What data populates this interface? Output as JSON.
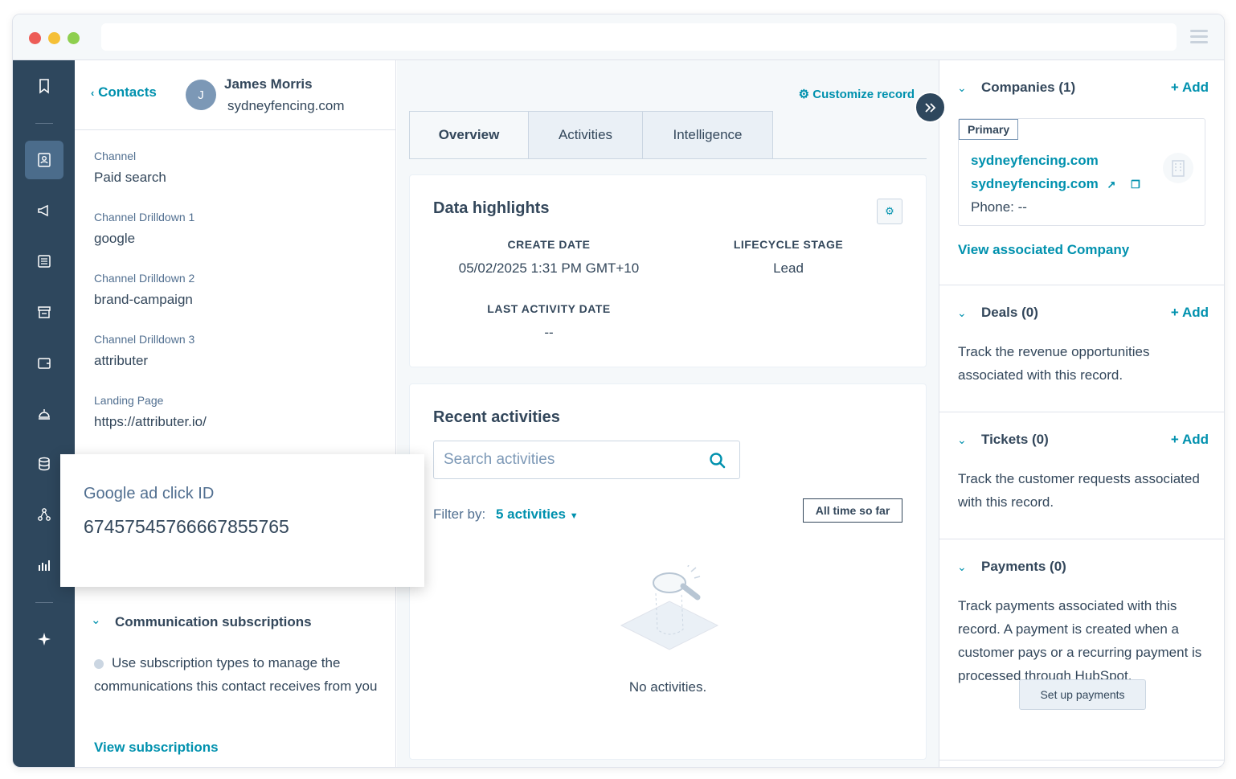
{
  "contact": {
    "back_label": "Contacts",
    "avatar_initial": "J",
    "name": "James Morris",
    "domain": "sydneyfencing.com"
  },
  "properties": [
    {
      "label": "Channel",
      "value": "Paid search"
    },
    {
      "label": "Channel Drilldown 1",
      "value": "google"
    },
    {
      "label": "Channel Drilldown 2",
      "value": "brand-campaign"
    },
    {
      "label": "Channel Drilldown 3",
      "value": "attributer"
    },
    {
      "label": "Landing Page",
      "value": "https://attributer.io/"
    }
  ],
  "popup": {
    "label": "Google ad click ID",
    "value": "674575457666678557​65"
  },
  "subscriptions": {
    "title": "Communication subscriptions",
    "text": "Use subscription types to manage the communications this contact receives from you",
    "link": "View subscriptions"
  },
  "middle": {
    "customize": "Customize record",
    "tabs": [
      "Overview",
      "Activities",
      "Intelligence"
    ],
    "highlights_title": "Data highlights",
    "highlights": [
      {
        "key": "CREATE DATE",
        "value": "05/02/2025 1:31 PM GMT+10"
      },
      {
        "key": "LIFECYCLE STAGE",
        "value": "Lead"
      },
      {
        "key": "LAST ACTIVITY DATE",
        "value": "--"
      }
    ],
    "recent_title": "Recent activities",
    "search_placeholder": "Search activities",
    "filter_label": "Filter by:",
    "filter_value": "5 activities",
    "time_filter": "All time so far",
    "empty_text": "No activities."
  },
  "right": {
    "add_label": "+ Add",
    "companies_title": "Companies (1)",
    "primary_badge": "Primary",
    "company_name": "sydneyfencing.com",
    "company_domain": "sydneyfencing.com",
    "company_phone": "Phone: --",
    "view_company": "View associated Company",
    "deals_title": "Deals (0)",
    "deals_desc": "Track the revenue opportunities associated with this record.",
    "tickets_title": "Tickets (0)",
    "tickets_desc": "Track the customer requests associated with this record.",
    "payments_title": "Payments (0)",
    "payments_desc": "Track payments associated with this record. A payment is created when a customer pays or a recurring payment is processed through HubSpot.",
    "setup_payments": "Set up payments"
  },
  "colors": {
    "nav_bg": "#2e475d",
    "link": "#0091ae",
    "text": "#33475b"
  }
}
